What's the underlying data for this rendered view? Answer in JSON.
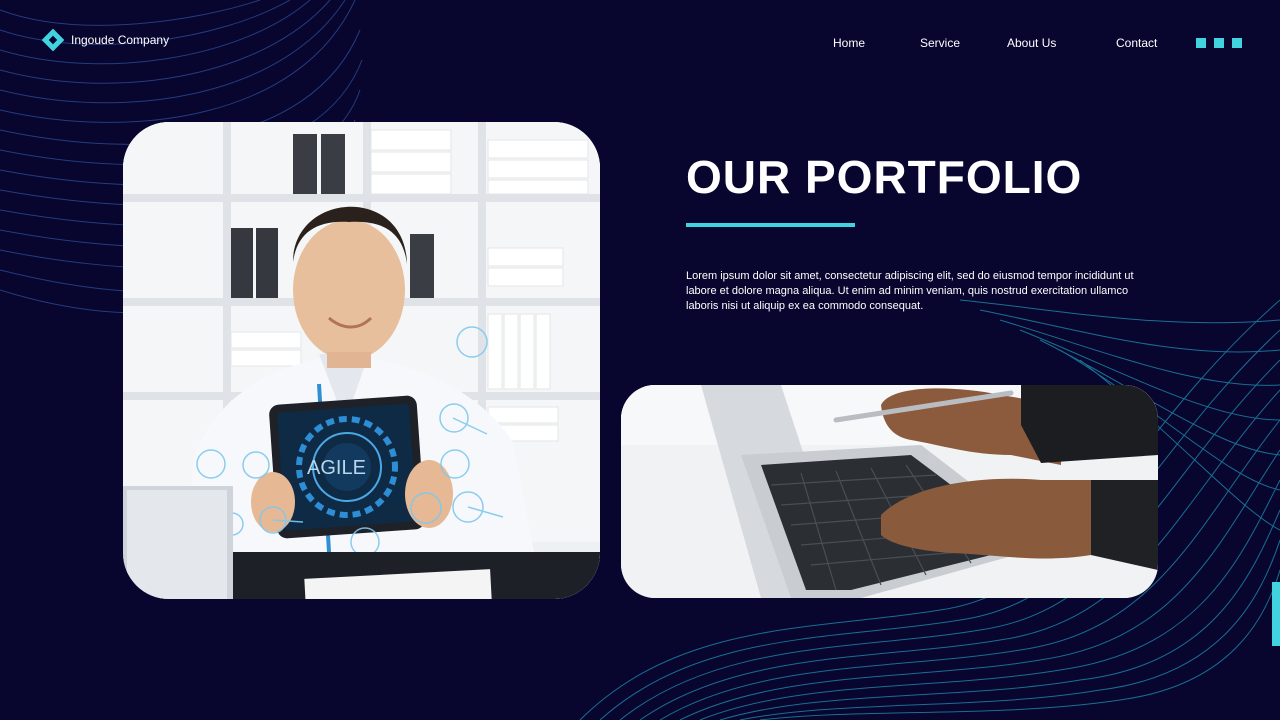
{
  "header": {
    "company_name": "Ingoude Company",
    "nav": [
      "Home",
      "Service",
      "About Us",
      "Contact"
    ]
  },
  "main": {
    "title": "OUR PORTFOLIO",
    "body": "Lorem ipsum dolor sit amet, consectetur adipiscing elit, sed do eiusmod tempor incididunt ut labore et dolore magna aliqua. Ut enim ad minim veniam, quis nostrud exercitation ullamco laboris nisi ut aliquip ex ea commodo consequat.",
    "photo1": {
      "tablet_text": "AGILE"
    }
  },
  "colors": {
    "background": "#08052e",
    "accent": "#41d4e0"
  }
}
